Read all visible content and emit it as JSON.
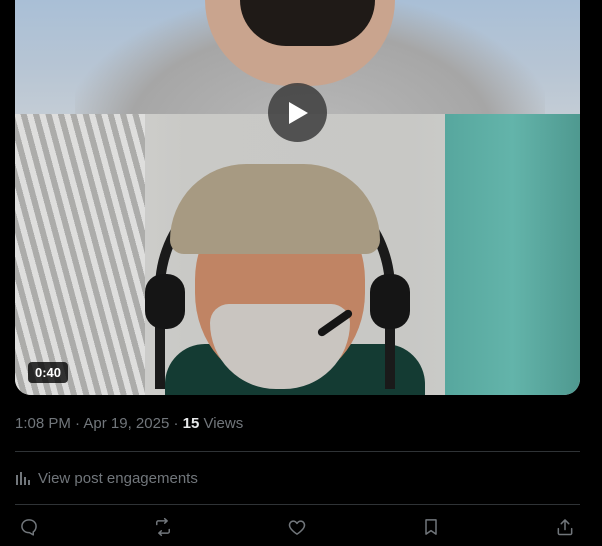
{
  "video": {
    "duration": "0:40",
    "play_icon": "play-icon"
  },
  "meta": {
    "time": "1:08 PM",
    "separator1": " · ",
    "date": "Apr 19, 2025",
    "separator2": " · ",
    "views_count": "15",
    "views_label": " Views"
  },
  "engagements": {
    "label": "View post engagements",
    "icon": "analytics-icon"
  },
  "actions": [
    {
      "name": "reply",
      "icon": "reply-icon"
    },
    {
      "name": "repost",
      "icon": "repost-icon"
    },
    {
      "name": "like",
      "icon": "like-icon"
    },
    {
      "name": "bookmark",
      "icon": "bookmark-icon"
    },
    {
      "name": "share",
      "icon": "share-icon"
    }
  ],
  "colors": {
    "background": "#000000",
    "secondary_text": "#71767b",
    "primary_text": "#e7e9ea",
    "divider": "#2f3336"
  }
}
